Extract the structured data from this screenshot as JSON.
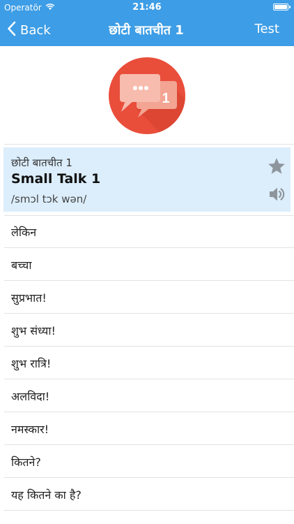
{
  "status_bar": {
    "carrier": "Operatör",
    "time": "21:46"
  },
  "nav": {
    "back_label": "Back",
    "title": "छोटी बातचीत 1",
    "test_label": "Test"
  },
  "hero": {
    "badge_number": "1",
    "circle_color": "#e94e3b",
    "bubble_color": "#f7bcae"
  },
  "selected": {
    "native": "छोटी बातचीत 1",
    "english": "Small Talk 1",
    "phonetic": "/smɔl tɔk wən/",
    "highlight_color": "#dceefc"
  },
  "colors": {
    "accent": "#3d9de6",
    "icon_gray": "#8e959c"
  },
  "phrases": [
    "लेकिन",
    "बच्चा",
    "सुप्रभात!",
    "शुभ संध्या!",
    "शुभ रात्रि!",
    "अलविदा!",
    "नमस्कार!",
    "कितने?",
    "यह कितने का है?"
  ]
}
